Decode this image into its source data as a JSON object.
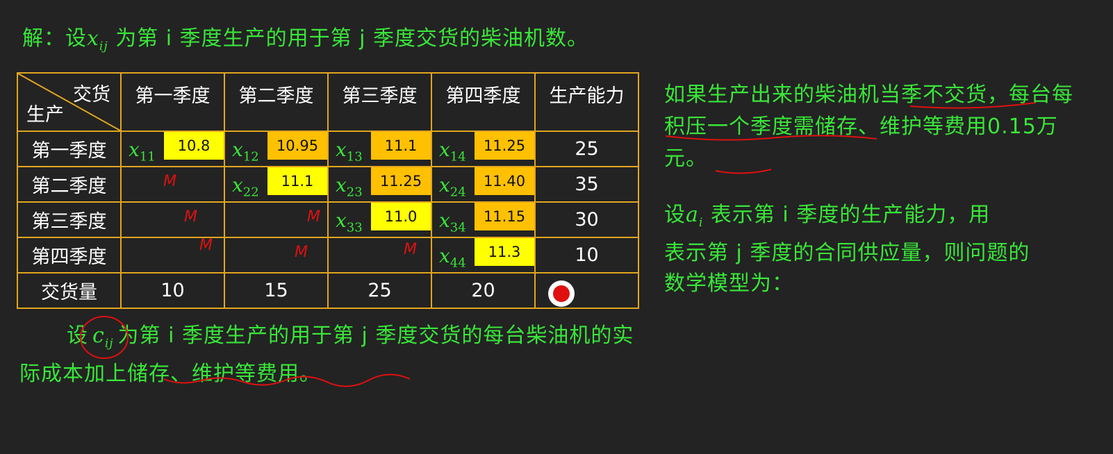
{
  "title": {
    "prefix": "解：设",
    "var": "x",
    "sub": "ij",
    "rest": "为第 i 季度生产的用于第 j 季度交货的柴油机数。"
  },
  "table": {
    "corner_top": "交货",
    "corner_bottom": "生产",
    "columns": [
      "第一季度",
      "第二季度",
      "第三季度",
      "第四季度",
      "生产能力"
    ],
    "rows": [
      {
        "label": "第一季度",
        "cells": [
          {
            "var": "x",
            "sub": "11",
            "cost": "10.8",
            "color": "yellow"
          },
          {
            "var": "x",
            "sub": "12",
            "cost": "10.95",
            "color": "orange"
          },
          {
            "var": "x",
            "sub": "13",
            "cost": "11.1",
            "color": "orange"
          },
          {
            "var": "x",
            "sub": "14",
            "cost": "11.25",
            "color": "orange"
          }
        ],
        "capacity": "25"
      },
      {
        "label": "第二季度",
        "cells": [
          {
            "mark": "M"
          },
          {
            "var": "x",
            "sub": "22",
            "cost": "11.1",
            "color": "yellow"
          },
          {
            "var": "x",
            "sub": "23",
            "cost": "11.25",
            "color": "orange"
          },
          {
            "var": "x",
            "sub": "24",
            "cost": "11.40",
            "color": "orange"
          }
        ],
        "capacity": "35"
      },
      {
        "label": "第三季度",
        "cells": [
          {
            "mark": "M"
          },
          {
            "mark": "M"
          },
          {
            "var": "x",
            "sub": "33",
            "cost": "11.0",
            "color": "yellow"
          },
          {
            "var": "x",
            "sub": "34",
            "cost": "11.15",
            "color": "orange"
          }
        ],
        "capacity": "30"
      },
      {
        "label": "第四季度",
        "cells": [
          {
            "mark": "M"
          },
          {
            "mark": "M"
          },
          {
            "mark": "M"
          },
          {
            "var": "x",
            "sub": "44",
            "cost": "11.3",
            "color": "yellow"
          }
        ],
        "capacity": "10"
      }
    ],
    "delivery_label": "交货量",
    "delivery": [
      "10",
      "15",
      "25",
      "20"
    ]
  },
  "bottom": {
    "prefix": "设",
    "var": "c",
    "sub": "ij",
    "rest": "为第 i 季度生产的用于第 j 季度交货的每台柴油机的实际成本加上储存、维护等费用。"
  },
  "right1": {
    "text": "如果生产出来的柴油机当季不交货，每台每积压一个季度需储存、维护等费用0.15万元。"
  },
  "right2": {
    "prefix": "设",
    "var": "a",
    "sub": "i",
    "line1_rest": "表示第 i 季度的生产能力，用",
    "line2": "表示第 j 季度的合同供应量，则问题的",
    "line3": "数学模型为："
  },
  "colors": {
    "background": "#232323",
    "text_green": "#39e639",
    "table_border": "#e2a61e",
    "cost_yellow": "#ffff00",
    "cost_orange": "#ffc000",
    "annotation_red": "#e01010"
  }
}
